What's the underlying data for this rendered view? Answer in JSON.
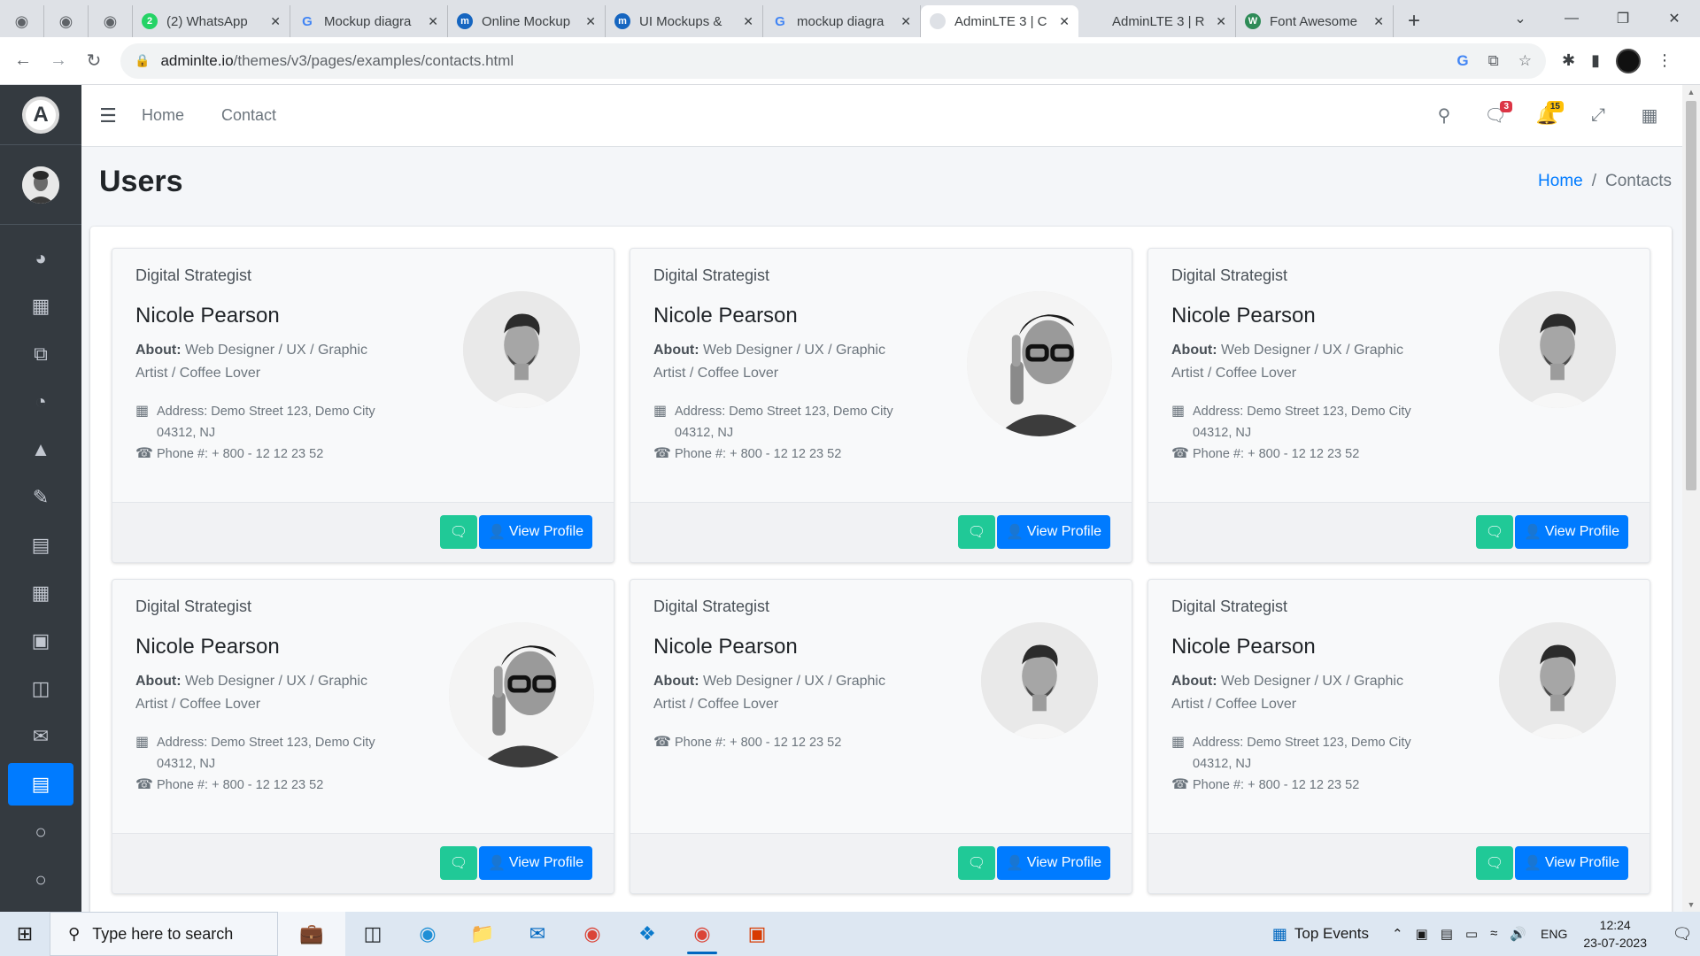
{
  "browser": {
    "tabs": [
      {
        "title": "",
        "icon": "globe-icon",
        "close": false
      },
      {
        "title": "",
        "icon": "globe-icon",
        "close": false
      },
      {
        "title": "",
        "icon": "globe-icon",
        "close": false
      },
      {
        "title": "(2) WhatsApp",
        "icon": "whatsapp-icon",
        "close": true
      },
      {
        "title": "Mockup diagra",
        "icon": "google-icon",
        "close": true
      },
      {
        "title": "Online Mockup",
        "icon": "moqups-icon",
        "close": true
      },
      {
        "title": "UI Mockups &",
        "icon": "moqups-icon",
        "close": true
      },
      {
        "title": "mockup diagra",
        "icon": "google-icon",
        "close": true
      },
      {
        "title": "AdminLTE 3 | C",
        "icon": "adminlte-icon",
        "close": true,
        "active": true
      },
      {
        "title": "AdminLTE 3 | R",
        "icon": "adminlte-icon",
        "close": true
      },
      {
        "title": "Font Awesome",
        "icon": "fontawesome-icon",
        "close": true
      }
    ],
    "url_host": "adminlte.io",
    "url_path": "/themes/v3/pages/examples/contacts.html"
  },
  "topnav": {
    "links": [
      "Home",
      "Contact"
    ],
    "messages_badge": "3",
    "notifications_badge": "15"
  },
  "page": {
    "title": "Users",
    "breadcrumb_home": "Home",
    "breadcrumb_current": "Contacts"
  },
  "contacts": [
    {
      "header": "Digital Strategist",
      "name": "Nicole Pearson",
      "about_label": "About:",
      "about": " Web Designer / UX / Graphic Artist / Coffee Lover",
      "address": "Address: Demo Street 123, Demo City 04312, NJ",
      "phone": "Phone #: + 800 - 12 12 23 52",
      "photo": "man-portrait",
      "chat_label": "",
      "profile_label": "View Profile"
    },
    {
      "header": "Digital Strategist",
      "name": "Nicole Pearson",
      "about_label": "About:",
      "about": " Web Designer / UX / Graphic Artist / Coffee Lover",
      "address": "Address: Demo Street 123, Demo City 04312, NJ",
      "phone": "Phone #: + 800 - 12 12 23 52",
      "photo": "man-glasses",
      "chat_label": "",
      "profile_label": "View Profile"
    },
    {
      "header": "Digital Strategist",
      "name": "Nicole Pearson",
      "about_label": "About:",
      "about": " Web Designer / UX / Graphic Artist / Coffee Lover",
      "address": "Address: Demo Street 123, Demo City 04312, NJ",
      "phone": "Phone #: + 800 - 12 12 23 52",
      "photo": "man-portrait",
      "chat_label": "",
      "profile_label": "View Profile"
    },
    {
      "header": "Digital Strategist",
      "name": "Nicole Pearson",
      "about_label": "About:",
      "about": " Web Designer / UX / Graphic Artist / Coffee Lover",
      "address": "Address: Demo Street 123, Demo City 04312, NJ",
      "phone": "Phone #: + 800 - 12 12 23 52",
      "photo": "man-glasses",
      "chat_label": "",
      "profile_label": "View Profile"
    },
    {
      "header": "Digital Strategist",
      "name": "Nicole Pearson",
      "about_label": "About:",
      "about": " Web Designer / UX / Graphic Artist / Coffee Lover",
      "address": "",
      "phone": "Phone #: + 800 - 12 12 23 52",
      "photo": "man-portrait",
      "chat_label": "",
      "profile_label": "View Profile"
    },
    {
      "header": "Digital Strategist",
      "name": "Nicole Pearson",
      "about_label": "About:",
      "about": " Web Designer / UX / Graphic Artist / Coffee Lover",
      "address": "Address: Demo Street 123, Demo City 04312, NJ",
      "phone": "Phone #: + 800 - 12 12 23 52",
      "photo": "man-portrait",
      "chat_label": "",
      "profile_label": "View Profile"
    }
  ],
  "taskbar": {
    "search_placeholder": "Type here to search",
    "top_events": "Top Events",
    "language": "ENG",
    "time": "12:24",
    "date": "23-07-2023"
  },
  "colors": {
    "primary": "#007bff",
    "teal": "#20c997",
    "sidebar": "#343a40",
    "badge_red": "#dc3545",
    "badge_yellow": "#ffc107"
  }
}
